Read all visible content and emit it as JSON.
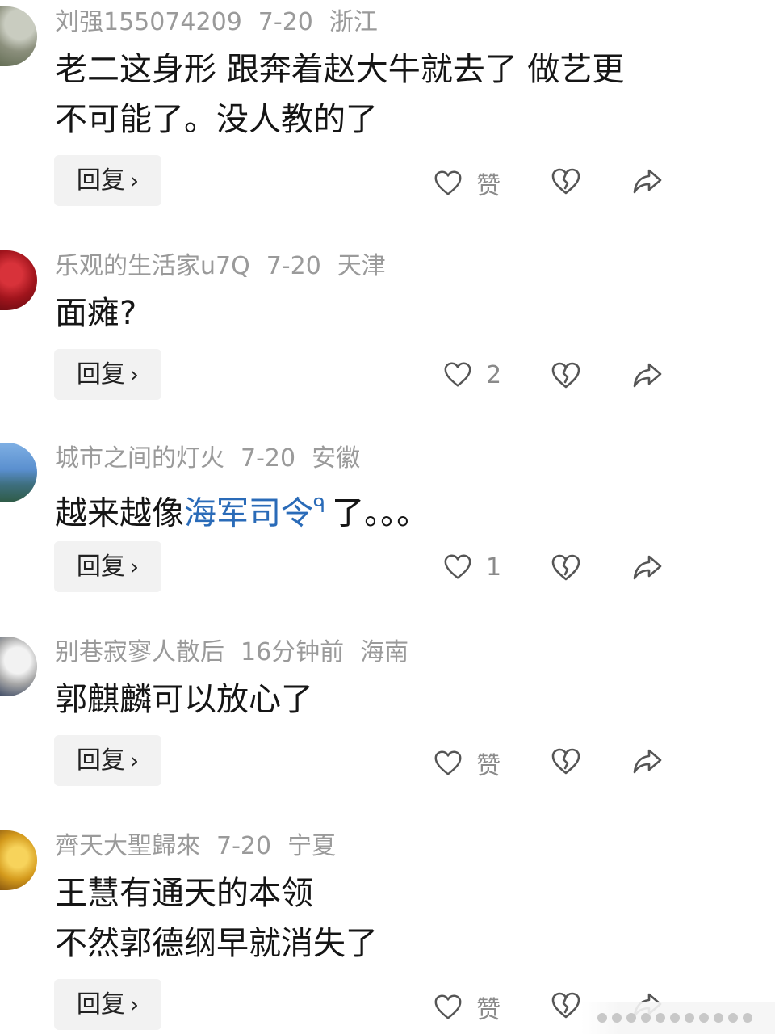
{
  "comments": [
    {
      "username": "刘强155074209",
      "date": "7-20",
      "location": "浙江",
      "lines": [
        "老二这身形 跟奔着赵大牛就去了 做艺更",
        "不可能了。没人教的了"
      ],
      "reply_label": "回复",
      "like_label": "赞"
    },
    {
      "username": "乐观的生活家u7Q",
      "date": "7-20",
      "location": "天津",
      "lines": [
        "面瘫?"
      ],
      "reply_label": "回复",
      "like_label": "2"
    },
    {
      "username": "城市之间的灯火",
      "date": "7-20",
      "location": "安徽",
      "text_prefix": "越来越像",
      "link_text": "海军司令",
      "text_suffix": "了。。。",
      "reply_label": "回复",
      "like_label": "1"
    },
    {
      "username": "别巷寂寥人散后",
      "date": "16分钟前",
      "location": "海南",
      "lines": [
        "郭麒麟可以放心了"
      ],
      "reply_label": "回复",
      "like_label": "赞"
    },
    {
      "username": "齊天大聖歸來",
      "date": "7-20",
      "location": "宁夏",
      "lines": [
        "王慧有通天的本领",
        "不然郭德纲早就消失了"
      ],
      "reply_label": "回复",
      "like_label": "赞"
    }
  ],
  "icons": {
    "like": "heart-outline-icon",
    "dislike": "broken-heart-icon",
    "share": "share-arrow-icon",
    "reply_chevron": "chevron-right-icon",
    "search_mark": "search-icon"
  },
  "colors": {
    "meta_text": "#9a9a9a",
    "body_text": "#151515",
    "link": "#2a6bb8",
    "button_bg": "#f2f2f2",
    "icon": "#555555"
  }
}
